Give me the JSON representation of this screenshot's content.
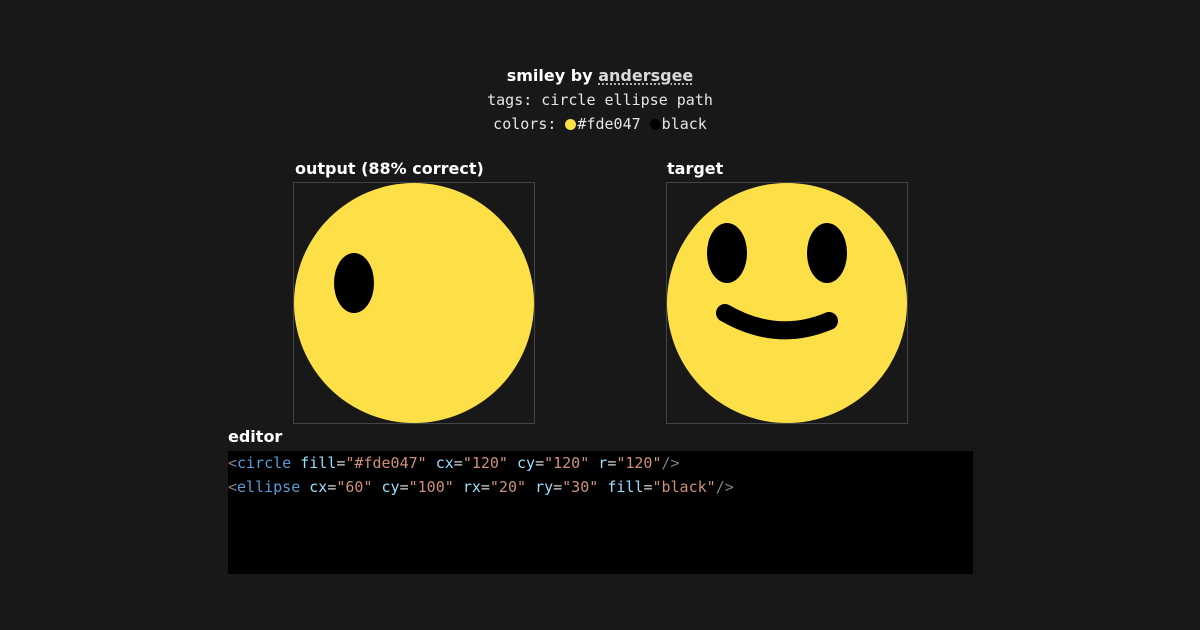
{
  "header": {
    "title": "smiley",
    "by": "by",
    "author": "andersgee",
    "tags_label": "tags:",
    "tags": "circle ellipse path",
    "colors_label": "colors:",
    "colors": [
      {
        "name": "#fde047",
        "hex": "#fde047"
      },
      {
        "name": "black",
        "hex": "#000000"
      }
    ]
  },
  "output": {
    "label": "output (88% correct)"
  },
  "target": {
    "label": "target"
  },
  "editor": {
    "label": "editor",
    "lines": [
      [
        {
          "t": "punct",
          "v": "<"
        },
        {
          "t": "tag",
          "v": "circle"
        },
        {
          "t": "ws",
          "v": " "
        },
        {
          "t": "attr",
          "v": "fill"
        },
        {
          "t": "eq",
          "v": "="
        },
        {
          "t": "str",
          "v": "\"#fde047\""
        },
        {
          "t": "ws",
          "v": " "
        },
        {
          "t": "attr",
          "v": "cx"
        },
        {
          "t": "eq",
          "v": "="
        },
        {
          "t": "str",
          "v": "\"120\""
        },
        {
          "t": "ws",
          "v": " "
        },
        {
          "t": "attr",
          "v": "cy"
        },
        {
          "t": "eq",
          "v": "="
        },
        {
          "t": "str",
          "v": "\"120\""
        },
        {
          "t": "ws",
          "v": " "
        },
        {
          "t": "attr",
          "v": "r"
        },
        {
          "t": "eq",
          "v": "="
        },
        {
          "t": "str",
          "v": "\"120\""
        },
        {
          "t": "punct",
          "v": "/>"
        }
      ],
      [
        {
          "t": "punct",
          "v": "<"
        },
        {
          "t": "tag",
          "v": "ellipse"
        },
        {
          "t": "ws",
          "v": " "
        },
        {
          "t": "attr",
          "v": "cx"
        },
        {
          "t": "eq",
          "v": "="
        },
        {
          "t": "str",
          "v": "\"60\""
        },
        {
          "t": "ws",
          "v": " "
        },
        {
          "t": "attr",
          "v": "cy"
        },
        {
          "t": "eq",
          "v": "="
        },
        {
          "t": "str",
          "v": "\"100\""
        },
        {
          "t": "ws",
          "v": " "
        },
        {
          "t": "attr",
          "v": "rx"
        },
        {
          "t": "eq",
          "v": "="
        },
        {
          "t": "str",
          "v": "\"20\""
        },
        {
          "t": "ws",
          "v": " "
        },
        {
          "t": "attr",
          "v": "ry"
        },
        {
          "t": "eq",
          "v": "="
        },
        {
          "t": "str",
          "v": "\"30\""
        },
        {
          "t": "ws",
          "v": " "
        },
        {
          "t": "attr",
          "v": "fill"
        },
        {
          "t": "eq",
          "v": "="
        },
        {
          "t": "str",
          "v": "\"black\""
        },
        {
          "t": "punct",
          "v": "/>"
        }
      ]
    ]
  }
}
